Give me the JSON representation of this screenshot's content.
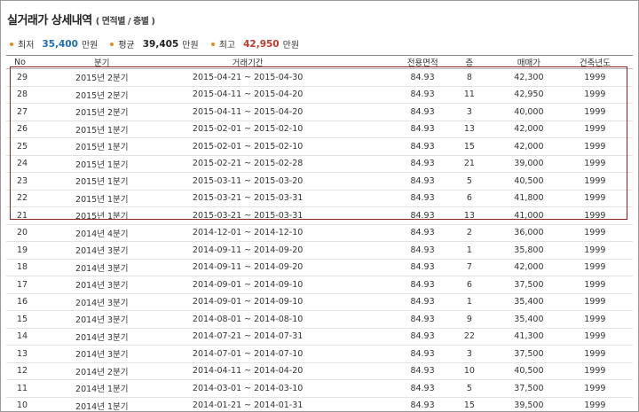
{
  "header": {
    "title": "실거래가 상세내역",
    "subtitle": "( 면적별 / 층별 )"
  },
  "summary": [
    {
      "label": "최저",
      "value": "35,400",
      "unit": "만원",
      "color": "#1a6eb5"
    },
    {
      "label": "평균",
      "value": "39,405",
      "unit": "만원",
      "color": "#222222"
    },
    {
      "label": "최고",
      "value": "42,950",
      "unit": "만원",
      "color": "#c0392b"
    }
  ],
  "table": {
    "headers": [
      "No",
      "분기",
      "거래기간",
      "전용면적",
      "층",
      "매매가",
      "건축년도"
    ],
    "rows": [
      {
        "no": "29",
        "quarter": "2015년 2분기",
        "period": "2015-04-21 ~ 2015-04-30",
        "area": "84.93",
        "floor": "8",
        "price": "42,300",
        "year": "1999"
      },
      {
        "no": "28",
        "quarter": "2015년 2분기",
        "period": "2015-04-11 ~ 2015-04-20",
        "area": "84.93",
        "floor": "11",
        "price": "42,950",
        "year": "1999"
      },
      {
        "no": "27",
        "quarter": "2015년 2분기",
        "period": "2015-04-11 ~ 2015-04-20",
        "area": "84.93",
        "floor": "3",
        "price": "40,000",
        "year": "1999"
      },
      {
        "no": "26",
        "quarter": "2015년 1분기",
        "period": "2015-02-01 ~ 2015-02-10",
        "area": "84.93",
        "floor": "13",
        "price": "42,000",
        "year": "1999"
      },
      {
        "no": "25",
        "quarter": "2015년 1분기",
        "period": "2015-02-01 ~ 2015-02-10",
        "area": "84.93",
        "floor": "15",
        "price": "42,000",
        "year": "1999"
      },
      {
        "no": "24",
        "quarter": "2015년 1분기",
        "period": "2015-02-21 ~ 2015-02-28",
        "area": "84.93",
        "floor": "21",
        "price": "39,000",
        "year": "1999"
      },
      {
        "no": "23",
        "quarter": "2015년 1분기",
        "period": "2015-03-11 ~ 2015-03-20",
        "area": "84.93",
        "floor": "5",
        "price": "40,500",
        "year": "1999"
      },
      {
        "no": "22",
        "quarter": "2015년 1분기",
        "period": "2015-03-21 ~ 2015-03-31",
        "area": "84.93",
        "floor": "6",
        "price": "41,800",
        "year": "1999"
      },
      {
        "no": "21",
        "quarter": "2015년 1분기",
        "period": "2015-03-21 ~ 2015-03-31",
        "area": "84.93",
        "floor": "13",
        "price": "41,000",
        "year": "1999"
      },
      {
        "no": "20",
        "quarter": "2014년 4분기",
        "period": "2014-12-01 ~ 2014-12-10",
        "area": "84.93",
        "floor": "2",
        "price": "36,000",
        "year": "1999"
      },
      {
        "no": "19",
        "quarter": "2014년 3분기",
        "period": "2014-09-11 ~ 2014-09-20",
        "area": "84.93",
        "floor": "1",
        "price": "35,800",
        "year": "1999"
      },
      {
        "no": "18",
        "quarter": "2014년 3분기",
        "period": "2014-09-11 ~ 2014-09-20",
        "area": "84.93",
        "floor": "7",
        "price": "42,000",
        "year": "1999"
      },
      {
        "no": "17",
        "quarter": "2014년 3분기",
        "period": "2014-09-01 ~ 2014-09-10",
        "area": "84.93",
        "floor": "6",
        "price": "37,500",
        "year": "1999"
      },
      {
        "no": "16",
        "quarter": "2014년 3분기",
        "period": "2014-09-01 ~ 2014-09-10",
        "area": "84.93",
        "floor": "1",
        "price": "35,400",
        "year": "1999"
      },
      {
        "no": "15",
        "quarter": "2014년 3분기",
        "period": "2014-08-01 ~ 2014-08-10",
        "area": "84.93",
        "floor": "9",
        "price": "35,400",
        "year": "1999"
      },
      {
        "no": "14",
        "quarter": "2014년 3분기",
        "period": "2014-07-21 ~ 2014-07-31",
        "area": "84.93",
        "floor": "22",
        "price": "41,300",
        "year": "1999"
      },
      {
        "no": "13",
        "quarter": "2014년 3분기",
        "period": "2014-07-01 ~ 2014-07-10",
        "area": "84.93",
        "floor": "3",
        "price": "37,500",
        "year": "1999"
      },
      {
        "no": "12",
        "quarter": "2014년 2분기",
        "period": "2014-04-11 ~ 2014-04-20",
        "area": "84.93",
        "floor": "10",
        "price": "40,500",
        "year": "1999"
      },
      {
        "no": "11",
        "quarter": "2014년 1분기",
        "period": "2014-03-01 ~ 2014-03-10",
        "area": "84.93",
        "floor": "5",
        "price": "37,500",
        "year": "1999"
      },
      {
        "no": "10",
        "quarter": "2014년 1분기",
        "period": "2014-01-21 ~ 2014-01-31",
        "area": "84.93",
        "floor": "15",
        "price": "39,500",
        "year": "1999"
      }
    ]
  },
  "colors": {
    "accent_dot": "#e08a22",
    "highlight_border": "#8b2323"
  }
}
